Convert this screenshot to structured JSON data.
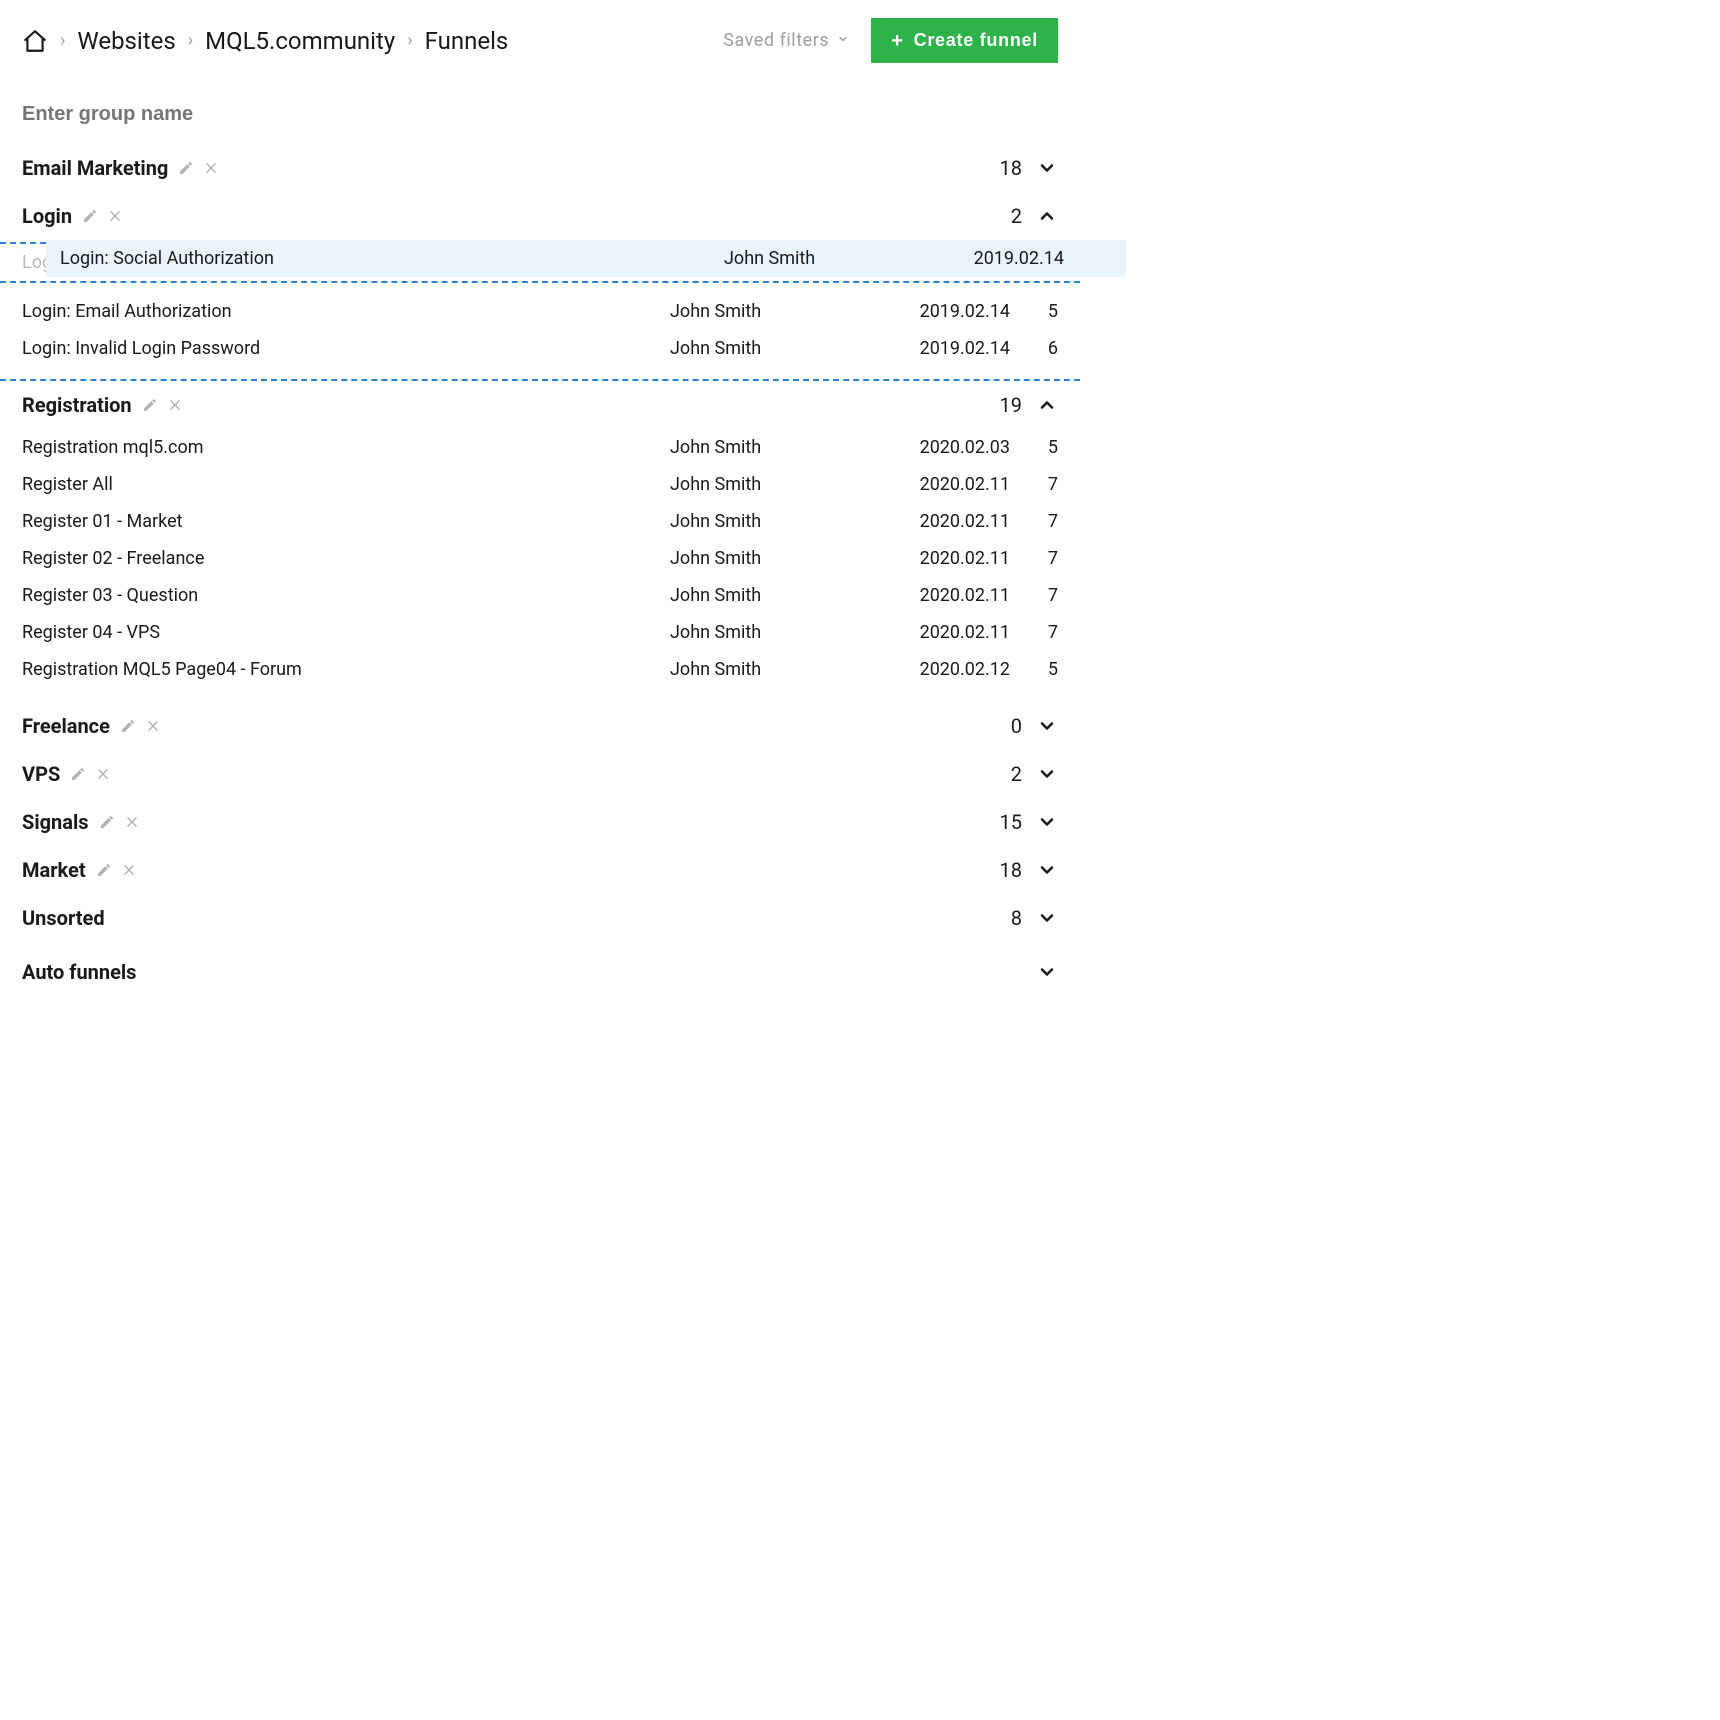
{
  "breadcrumbs": [
    "Websites",
    "MQL5.community",
    "Funnels"
  ],
  "toolbar": {
    "saved_filters_label": "Saved filters",
    "create_label": "Create funnel"
  },
  "group_input_placeholder": "Enter group name",
  "drag_item": {
    "name": "Login: Social Authorization",
    "user": "John Smith",
    "date": "2019.02.14"
  },
  "login_under": {
    "name": "Login: Social Authorization",
    "user": "John Smith",
    "date": "2019.02.14"
  },
  "groups": [
    {
      "name": "Email Marketing",
      "count": 18,
      "expanded": false,
      "has_actions": true
    },
    {
      "name": "Login",
      "count": 2,
      "expanded": true,
      "has_actions": true,
      "items": [
        {
          "name": "Login: Email Authorization",
          "user": "John Smith",
          "date": "2019.02.14",
          "count": 5
        },
        {
          "name": "Login: Invalid Login Password",
          "user": "John Smith",
          "date": "2019.02.14",
          "count": 6
        }
      ]
    },
    {
      "name": "Registration",
      "count": 19,
      "expanded": true,
      "has_actions": true,
      "items": [
        {
          "name": "Registration mql5.com",
          "user": "John Smith",
          "date": "2020.02.03",
          "count": 5
        },
        {
          "name": "Register All",
          "user": "John Smith",
          "date": "2020.02.11",
          "count": 7
        },
        {
          "name": "Register 01 - Market",
          "user": "John Smith",
          "date": "2020.02.11",
          "count": 7
        },
        {
          "name": "Register 02 - Freelance",
          "user": "John Smith",
          "date": "2020.02.11",
          "count": 7
        },
        {
          "name": "Register 03 - Question",
          "user": "John Smith",
          "date": "2020.02.11",
          "count": 7
        },
        {
          "name": "Register 04 - VPS",
          "user": "John Smith",
          "date": "2020.02.11",
          "count": 7
        },
        {
          "name": "Registration MQL5 Page04 - Forum",
          "user": "John Smith",
          "date": "2020.02.12",
          "count": 5
        }
      ]
    },
    {
      "name": "Freelance",
      "count": 0,
      "expanded": false,
      "has_actions": true
    },
    {
      "name": "VPS",
      "count": 2,
      "expanded": false,
      "has_actions": true
    },
    {
      "name": "Signals",
      "count": 15,
      "expanded": false,
      "has_actions": true
    },
    {
      "name": "Market",
      "count": 18,
      "expanded": false,
      "has_actions": true
    },
    {
      "name": "Unsorted",
      "count": 8,
      "expanded": false,
      "has_actions": false
    },
    {
      "name": "Auto funnels",
      "count": null,
      "expanded": false,
      "has_actions": false
    }
  ]
}
